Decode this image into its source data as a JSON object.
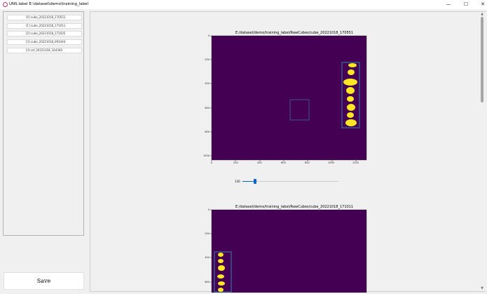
{
  "window": {
    "title": "UNS.label E:\\dataset\\demo\\training_label",
    "minimize": "—",
    "maximize": "☐",
    "close": "✕"
  },
  "file_list": [
    "[0] cube_20221018_170551",
    "[1] cube_20221018_171011",
    "[2] cube_20221018_171025",
    "[3] cube_20221018_091444",
    "[4] ref_20221018_164300"
  ],
  "save_label": "Save",
  "slider": {
    "value": "130",
    "fraction": 0.13
  },
  "figures": [
    {
      "title": "E:/dataset/demo/training_label/RawCubes/cube_20221018_170551",
      "yticks": [
        "0",
        "200",
        "400",
        "600",
        "800",
        "1000"
      ],
      "xticks": [
        "0",
        "200",
        "400",
        "600",
        "800",
        "1000",
        "1200"
      ]
    },
    {
      "title": "E:/dataset/demo/training_label/RawCubes/cube_20221018_171011",
      "yticks": [
        "0",
        "200",
        "400",
        "600"
      ]
    }
  ],
  "colors": {
    "background": "#440154",
    "object": "#fde725",
    "box": "#3b528b",
    "slider": "#0a64c8"
  }
}
